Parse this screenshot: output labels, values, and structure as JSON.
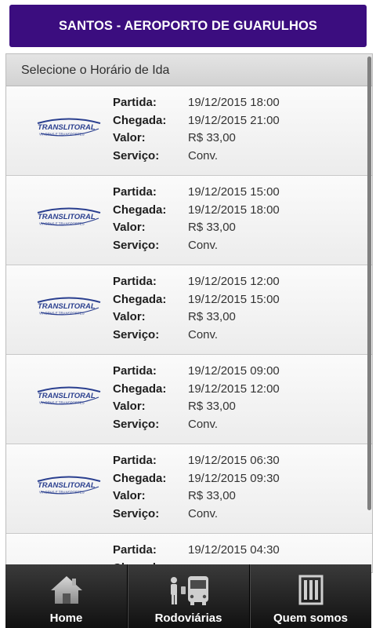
{
  "header": {
    "route": "SANTOS - AEROPORTO DE GUARULHOS"
  },
  "panel": {
    "title": "Selecione o Horário de Ida"
  },
  "labels": {
    "departure": "Partida:",
    "arrival": "Chegada:",
    "price": "Valor:",
    "service": "Serviço:"
  },
  "company": {
    "name": "TRANSLITORAL",
    "tagline": "VIAGENS E TRANSPORTES",
    "logo_color": "#2a3f8f"
  },
  "trips": [
    {
      "departure": "19/12/2015 18:00",
      "arrival": "19/12/2015 21:00",
      "price": "R$ 33,00",
      "service": "Conv."
    },
    {
      "departure": "19/12/2015 15:00",
      "arrival": "19/12/2015 18:00",
      "price": "R$ 33,00",
      "service": "Conv."
    },
    {
      "departure": "19/12/2015 12:00",
      "arrival": "19/12/2015 15:00",
      "price": "R$ 33,00",
      "service": "Conv."
    },
    {
      "departure": "19/12/2015 09:00",
      "arrival": "19/12/2015 12:00",
      "price": "R$ 33,00",
      "service": "Conv."
    },
    {
      "departure": "19/12/2015 06:30",
      "arrival": "19/12/2015 09:30",
      "price": "R$ 33,00",
      "service": "Conv."
    },
    {
      "departure": "19/12/2015 04:30",
      "arrival": "",
      "price": "",
      "service": ""
    }
  ],
  "nav": {
    "home": {
      "label": "Home",
      "icon": "house-icon"
    },
    "stations": {
      "label": "Rodoviárias",
      "icon": "bus-stop-icon"
    },
    "about": {
      "label": "Quem somos",
      "icon": "building-icon"
    }
  },
  "colors": {
    "header_bg": "#3b0d7f",
    "nav_bg": "#1c1c1c"
  }
}
